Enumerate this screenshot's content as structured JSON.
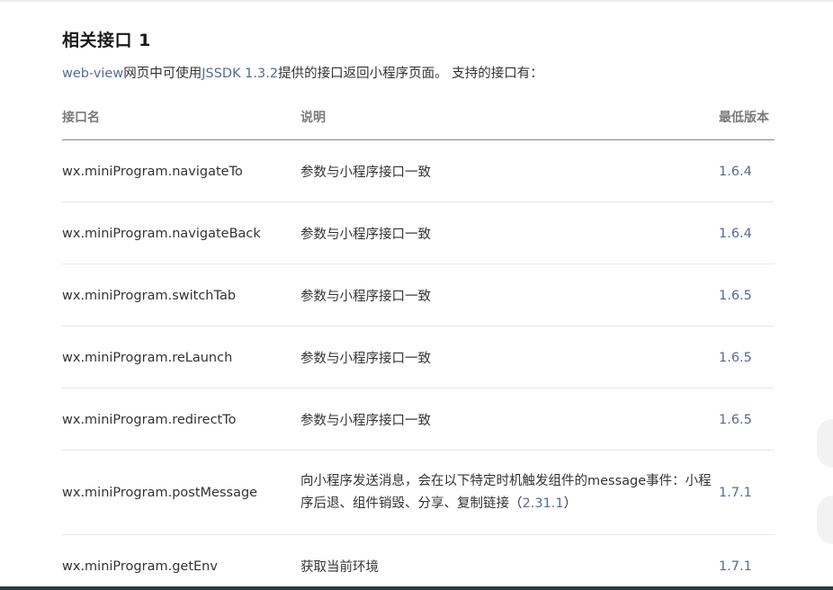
{
  "section": {
    "title": "相关接口 1",
    "intro_link1": "web-view",
    "intro_text1": "网页中可使用",
    "intro_link2": "JSSDK 1.3.2",
    "intro_text2": "提供的接口返回小程序页面。 支持的接口有："
  },
  "table": {
    "headers": [
      "接口名",
      "说明",
      "最低版本"
    ],
    "rows": [
      {
        "name": "wx.miniProgram.navigateTo",
        "desc": "参数与小程序接口一致",
        "version": "1.6.4"
      },
      {
        "name": "wx.miniProgram.navigateBack",
        "desc": "参数与小程序接口一致",
        "version": "1.6.4"
      },
      {
        "name": "wx.miniProgram.switchTab",
        "desc": "参数与小程序接口一致",
        "version": "1.6.5"
      },
      {
        "name": "wx.miniProgram.reLaunch",
        "desc": "参数与小程序接口一致",
        "version": "1.6.5"
      },
      {
        "name": "wx.miniProgram.redirectTo",
        "desc": "参数与小程序接口一致",
        "version": "1.6.5"
      },
      {
        "name": "wx.miniProgram.postMessage",
        "desc": "向小程序发送消息，会在以下特定时机触发组件的message事件：小程序后退、组件销毁、分享、复制链接（",
        "desc_version": "2.31.1",
        "desc_end": "）",
        "version": "1.7.1"
      },
      {
        "name": "wx.miniProgram.getEnv",
        "desc": "获取当前环境",
        "version": "1.7.1"
      }
    ]
  }
}
